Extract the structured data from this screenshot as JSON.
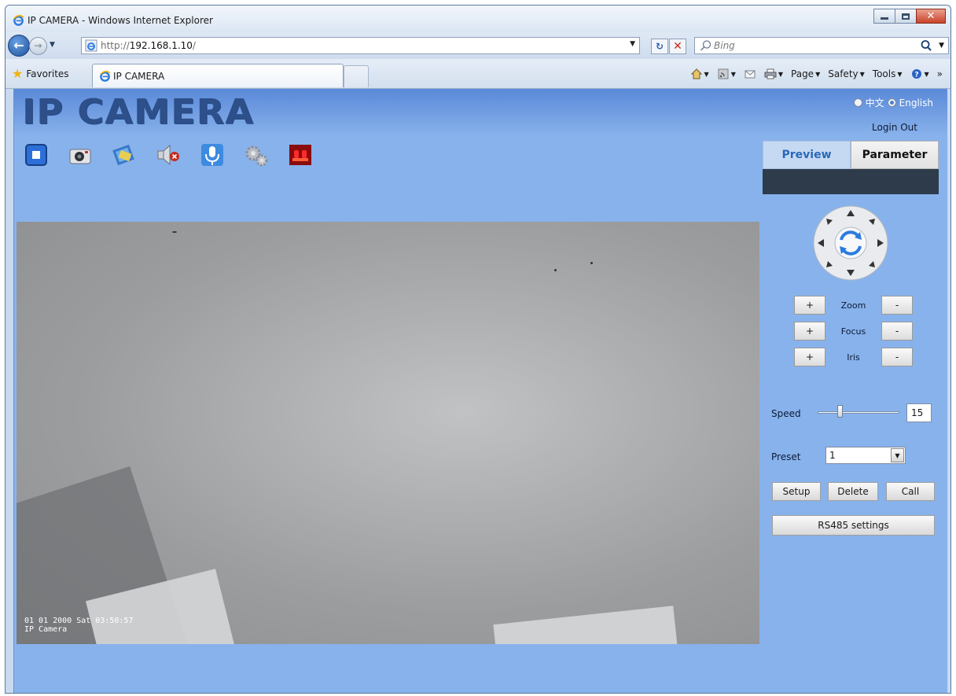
{
  "window": {
    "title": "IP CAMERA - Windows Internet Explorer"
  },
  "addressbar": {
    "url_prefix": "http://",
    "url_host": "192.168.1.10",
    "url_suffix": "/"
  },
  "search": {
    "placeholder": "Bing"
  },
  "favorites": {
    "label": "Favorites"
  },
  "tabs": [
    {
      "label": "IP CAMERA"
    }
  ],
  "commandbar": {
    "page": "Page",
    "safety": "Safety",
    "tools": "Tools"
  },
  "camera_page": {
    "logo": "IP CAMERA",
    "language": {
      "options": [
        "中文",
        "English"
      ],
      "selected": "English"
    },
    "login_out": "Login Out",
    "toolbar_icons": [
      "stop-icon",
      "snapshot-camera-icon",
      "record-icon",
      "speaker-muted-icon",
      "microphone-icon",
      "settings-gear-icon",
      "alarm-light-icon"
    ],
    "video": {
      "osd_line1": "01 01 2000 Sat 03:50:57",
      "osd_line2": "IP Camera"
    },
    "right_tabs": {
      "preview": "Preview",
      "parameter": "Parameter"
    },
    "controls": {
      "zoom": "Zoom",
      "focus": "Focus",
      "iris": "Iris",
      "plus": "+",
      "minus": "-"
    },
    "speed": {
      "label": "Speed",
      "value": "15",
      "slider_fraction": 0.26
    },
    "preset": {
      "label": "Preset",
      "value": "1"
    },
    "buttons": {
      "setup": "Setup",
      "delete": "Delete",
      "call": "Call",
      "rs485": "RS485 settings"
    }
  },
  "colors": {
    "page_bg": "#88b2eb",
    "logo": "#2d4f8a",
    "preview_tab_text": "#2a68b8"
  }
}
